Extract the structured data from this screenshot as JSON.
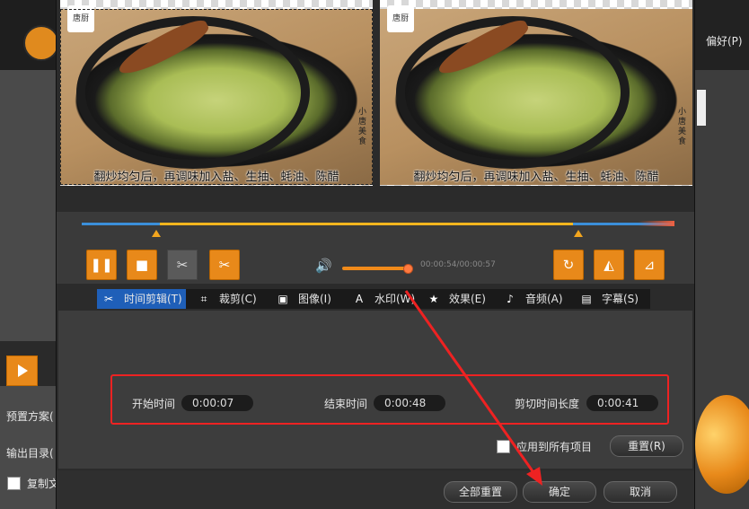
{
  "background": {
    "menu_label": "偏好(P)",
    "preset_label": "预置方案(",
    "output_label": "输出目录(",
    "copy_label": "复制文"
  },
  "preview": {
    "caption": "翻炒均匀后，再调味加入盐、生抽、蚝油、陈醋",
    "stamp": "小唐美食",
    "badge_text": "唐厨"
  },
  "player": {
    "time_display": "00:00:54/00:00:57",
    "volume_percent": 95
  },
  "tabs": [
    {
      "label": "时间剪辑(T)",
      "icon": "scissors-icon",
      "glyph": "✂"
    },
    {
      "label": "裁剪(C)",
      "icon": "crop-icon",
      "glyph": "⌗"
    },
    {
      "label": "图像(I)",
      "icon": "image-icon",
      "glyph": "▣"
    },
    {
      "label": "水印(W)",
      "icon": "watermark-icon",
      "glyph": "A"
    },
    {
      "label": "效果(E)",
      "icon": "star-icon",
      "glyph": "★"
    },
    {
      "label": "音频(A)",
      "icon": "music-icon",
      "glyph": "♪"
    },
    {
      "label": "字幕(S)",
      "icon": "subtitle-icon",
      "glyph": "▤"
    }
  ],
  "trim": {
    "start_label": "开始时间",
    "start_value": "0:00:07",
    "end_label": "结束时间",
    "end_value": "0:00:48",
    "duration_label": "剪切时间长度",
    "duration_value": "0:00:41"
  },
  "apply_all_label": "应用到所有项目",
  "buttons": {
    "reset": "重置(R)",
    "reset_all": "全部重置",
    "ok": "确定",
    "cancel": "取消"
  },
  "colors": {
    "accent_orange": "#e8891a",
    "tab_active": "#1f5fb8",
    "highlight_red": "#e22222",
    "timeline_blue": "#3b8fd9",
    "timeline_yellow": "#f2b51e"
  }
}
